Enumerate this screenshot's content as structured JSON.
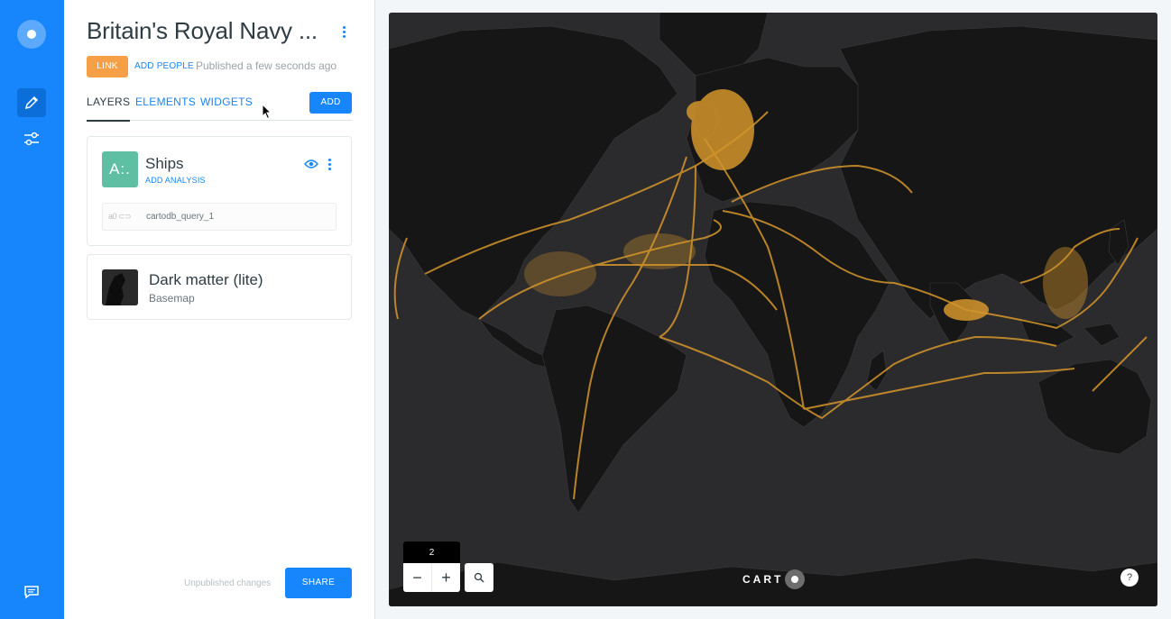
{
  "rail": {
    "icons": [
      "carto-logo-icon",
      "edit-pencil-icon",
      "settings-sliders-icon",
      "feedback-chat-icon"
    ]
  },
  "header": {
    "title": "Britain's Royal Navy ...",
    "link_badge": "LINK",
    "add_people": "ADD PEOPLE",
    "published_status": "Published a few seconds ago"
  },
  "tabs": [
    {
      "label": "LAYERS",
      "active": true
    },
    {
      "label": "ELEMENTS",
      "active": false
    },
    {
      "label": "WIDGETS",
      "active": false
    }
  ],
  "add_button": "ADD",
  "layers": [
    {
      "swatch": "A:.",
      "name": "Ships",
      "add_analysis": "ADD ANALYSIS",
      "source_icon": "a0",
      "source": "cartodb_query_1",
      "color": "#5fbfa3"
    }
  ],
  "basemap": {
    "name": "Dark matter (lite)",
    "subtitle": "Basemap"
  },
  "footer": {
    "unpublished": "Unpublished changes",
    "share": "SHARE"
  },
  "map": {
    "zoom_level": "2",
    "zoom_out": "−",
    "zoom_in": "+",
    "brand": "CART",
    "help": "?",
    "route_color": "#d4952b",
    "land_color": "#161616",
    "water_color": "#2b2b2d"
  }
}
